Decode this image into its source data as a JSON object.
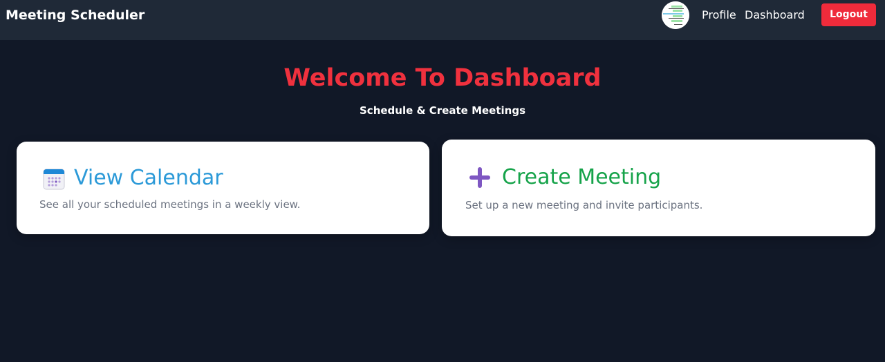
{
  "navbar": {
    "brand": "Meeting Scheduler",
    "links": [
      {
        "label": "Profile"
      },
      {
        "label": "Dashboard"
      }
    ],
    "logout_label": "Logout",
    "avatar_icon": "avatar-icon"
  },
  "main": {
    "title": "Welcome To Dashboard",
    "subtitle": "Schedule & Create Meetings",
    "cards": [
      {
        "icon": "calendar-icon",
        "title": "View Calendar",
        "description": "See all your scheduled meetings in a weekly view."
      },
      {
        "icon": "plus-icon",
        "title": "Create Meeting",
        "description": "Set up a new meeting and invite participants."
      }
    ]
  },
  "colors": {
    "background": "#111827",
    "navbar": "#1f2937",
    "accent_red": "#ef2b3b",
    "calendar_blue": "#2c9ad8",
    "create_green": "#16a34a",
    "plus_purple": "#7e57c2"
  }
}
